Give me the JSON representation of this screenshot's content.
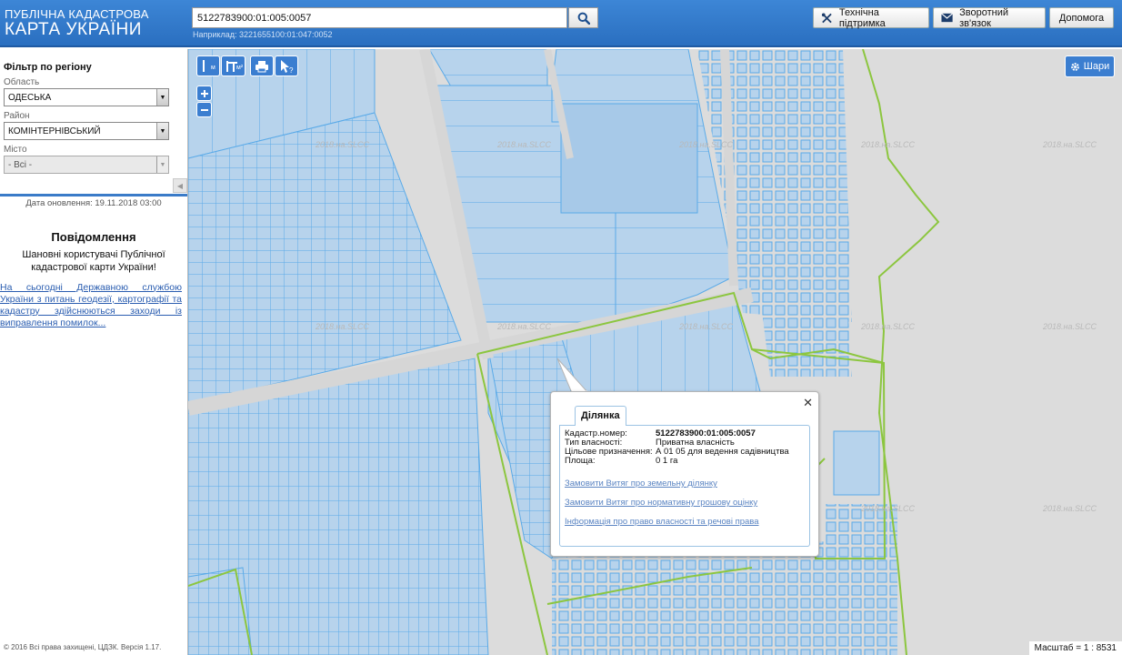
{
  "header": {
    "logo_line1": "ПУБЛІЧНА КАДАСТРОВА",
    "logo_line2": "КАРТА УКРАЇНИ",
    "search_value": "5122783900:01:005:0057",
    "search_hint": "Наприклад: 3221655100:01:047:0052",
    "buttons": {
      "support": "Технічна підтримка",
      "feedback": "Зворотний зв'язок",
      "help": "Допомога"
    }
  },
  "sidebar": {
    "filter_title": "Фільтр по регіону",
    "oblast_label": "Область",
    "oblast_value": "ОДЕСЬКА",
    "rayon_label": "Район",
    "rayon_value": "КОМІНТЕРНІВСЬКИЙ",
    "misto_label": "Місто",
    "misto_value": "- Всі -",
    "updated": "Дата оновлення: 19.11.2018 03:00",
    "notice_title": "Повідомлення",
    "notice_body": "Шановні користувачі Публічної кадастрової карти України!",
    "notice_link": "На сьогодні Державною службою України з питань геодезії, картографії та кадастру здійснюються заходи із виправлення помилок...",
    "copyright": "© 2016 Всі права захищені, ЦДЗК. Версія 1.17."
  },
  "map": {
    "tools": {
      "measure_line": "м",
      "measure_area": "м²"
    },
    "layers_label": "Шари",
    "scale": "Масштаб = 1 : 8531",
    "watermark": "2018.на.SLCC",
    "colors": {
      "parcel_fill": "#b7d3ec",
      "parcel_stroke": "#5aaae8",
      "boundary": "#8cc63f",
      "background": "#dcdcdc"
    }
  },
  "popup": {
    "tab": "Ділянка",
    "rows": [
      {
        "key": "Кадастр.номер:",
        "value": "5122783900:01:005:0057"
      },
      {
        "key": "Тип власності:",
        "value": "Приватна власність"
      },
      {
        "key": "Цільове призначення:",
        "value": "А 01 05 для ведення садівництва"
      },
      {
        "key": "Площа:",
        "value": "0 1 га"
      }
    ],
    "links": [
      "Замовити Витяг про земельну ділянку",
      "Замовити Витяг про нормативну грошову оцінку",
      "Інформація про право власності та речові права"
    ]
  }
}
